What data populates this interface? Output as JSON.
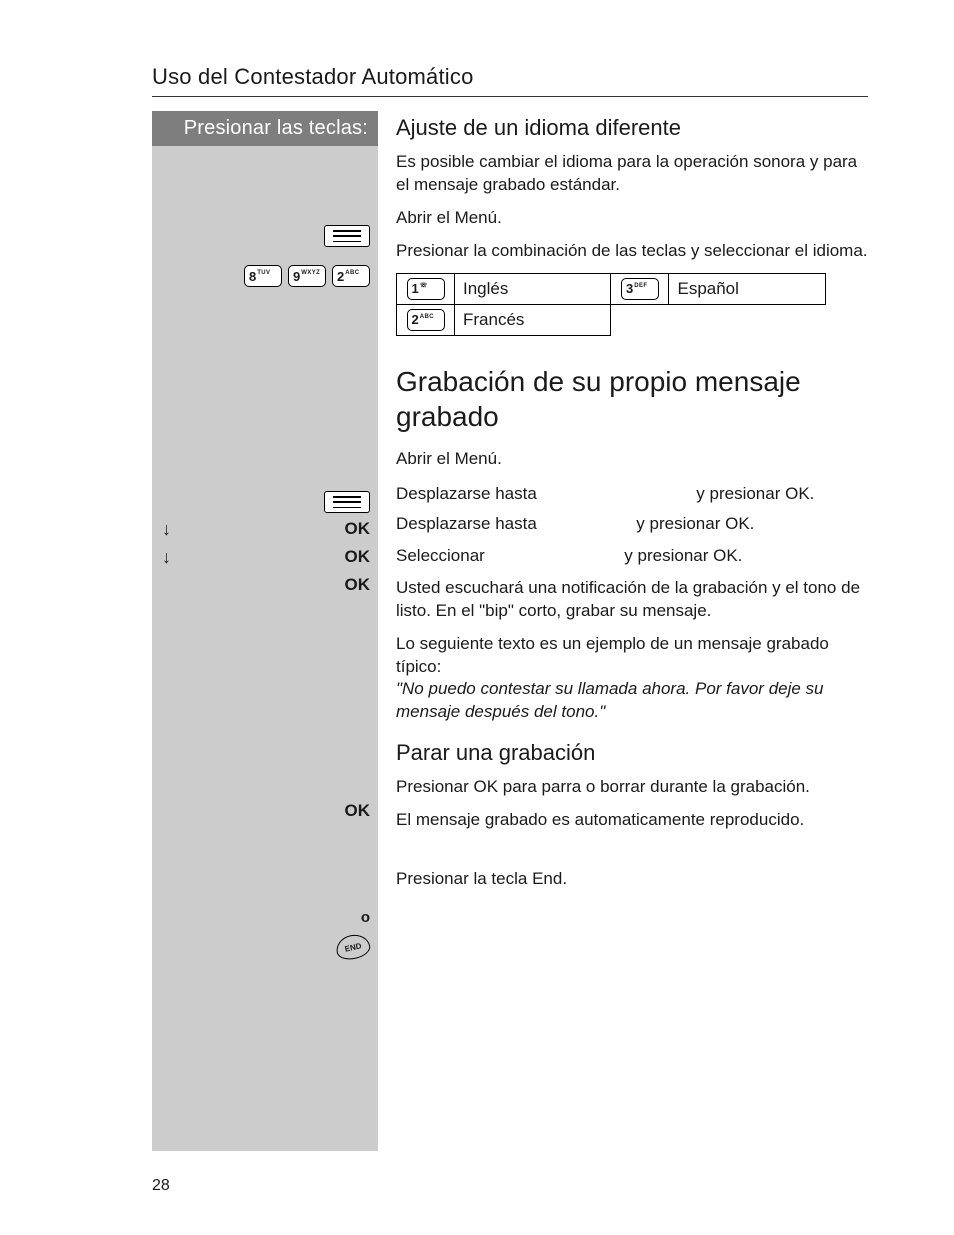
{
  "page_number": "28",
  "section_title": "Uso del Contestador Automático",
  "left_header": "Presionar las teclas:",
  "subheading_language": "Ajuste de un idioma diferente",
  "lang_intro": "Es posible cambiar el idioma para la operación sonora y para el mensaje grabado estándar.",
  "open_menu": "Abrir el Menú.",
  "press_combo": "Presionar la combinación de las teclas y seleccionar el idioma.",
  "keys": {
    "k8": "8",
    "k8s": "TUV",
    "k9": "9",
    "k9s": "WXYZ",
    "k2": "2",
    "k2s": "ABC",
    "k1": "1",
    "k3": "3",
    "k3s": "DEF"
  },
  "lang": {
    "ingles": "Inglés",
    "espanol": "Español",
    "frances": "Francés"
  },
  "big_heading": "Grabación de su propio mensaje grabado",
  "scroll_to": "Desplazarse hasta",
  "press_ok_suffix": "y presionar OK.",
  "select": "Seleccionar",
  "record_para1": "Usted escuchará una notificación de la grabación y el tono de listo. En el \"bip\" corto, grabar su mensaje.",
  "record_para2": "Lo seguiente texto es un ejemplo de un mensaje grabado típico:",
  "record_example": "\"No puedo contestar su llamada ahora. Por favor deje su mensaje después del tono.\"",
  "stop_heading": "Parar una grabación",
  "stop_text": "Presionar OK para parra o borrar durante la grabación.",
  "auto_play": "El mensaje grabado es automaticamente reproducido.",
  "o_label": "o",
  "press_end": "Presionar la tecla End.",
  "ok_label": "OK",
  "end_label": "END"
}
